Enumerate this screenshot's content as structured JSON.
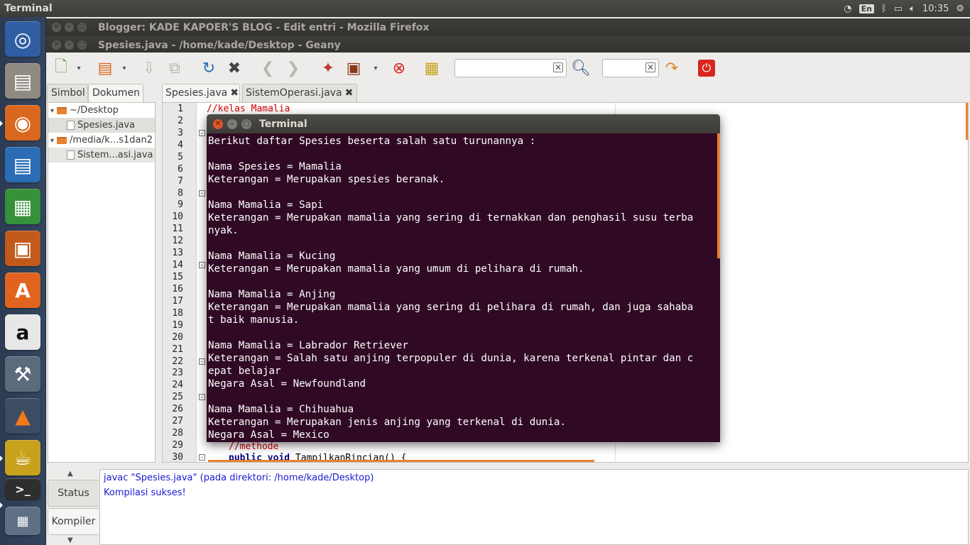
{
  "top_panel": {
    "title": "Terminal",
    "lang": "En",
    "clock": "10:35"
  },
  "windows": {
    "firefox_title": "Blogger: KADE KAPOER'S BLOG - Edit entri - Mozilla Firefox",
    "geany_title": "Spesies.java - /home/kade/Desktop - Geany"
  },
  "launcher": {
    "items": [
      "dash-home",
      "files",
      "firefox",
      "libreoffice-writer",
      "libreoffice-calc",
      "libreoffice-impress",
      "ubuntu-software-center",
      "amazon",
      "system-settings",
      "vlc",
      "geany",
      "terminal",
      "workspaces"
    ]
  },
  "sidebar": {
    "tabs": [
      "Simbol",
      "Dokumen"
    ],
    "tree": [
      {
        "label": "~/Desktop",
        "type": "folder"
      },
      {
        "label": "Spesies.java",
        "type": "file"
      },
      {
        "label": "/media/k...s1dan2",
        "type": "folder"
      },
      {
        "label": "Sistem...asi.java",
        "type": "file"
      }
    ]
  },
  "editor": {
    "tabs": [
      "Spesies.java",
      "SistemOperasi.java"
    ],
    "line_numbers": [
      "1",
      "2",
      "3",
      "4",
      "5",
      "6",
      "7",
      "8",
      "9",
      "10",
      "11",
      "12",
      "13",
      "14",
      "15",
      "16",
      "17",
      "18",
      "19",
      "20",
      "21",
      "22",
      "23",
      "24",
      "25",
      "26",
      "27",
      "28",
      "29",
      "30"
    ],
    "visible_code": {
      "line1": "//kelas Mamalia",
      "line29": "//methode",
      "line30_kw": "public void",
      "line30_rest": " TampilkanRincian() {"
    }
  },
  "terminal": {
    "title": "Terminal",
    "lines": [
      "Berikut daftar Spesies beserta salah satu turunannya :",
      "",
      "Nama Spesies = Mamalia",
      "Keterangan = Merupakan spesies beranak.",
      "",
      "Nama Mamalia = Sapi",
      "Keterangan = Merupakan mamalia yang sering di ternakkan dan penghasil susu terba",
      "nyak.",
      "",
      "Nama Mamalia = Kucing",
      "Keterangan = Merupakan mamalia yang umum di pelihara di rumah.",
      "",
      "Nama Mamalia = Anjing",
      "Keterangan = Merupakan mamalia yang sering di pelihara di rumah, dan juga sahaba",
      "t baik manusia.",
      "",
      "Nama Mamalia = Labrador Retriever",
      "Keterangan = Salah satu anjing terpopuler di dunia, karena terkenal pintar dan c",
      "epat belajar",
      "Negara Asal = Newfoundland",
      "",
      "Nama Mamalia = Chihuahua",
      "Keterangan = Merupakan jenis anjing yang terkenal di dunia.",
      "Negara Asal = Mexico"
    ]
  },
  "messages": {
    "tabs": [
      "Status",
      "Kompiler"
    ],
    "lines": [
      "javac \"Spesies.java\" (pada direktori: /home/kade/Desktop)",
      "Kompilasi sukses!"
    ]
  },
  "colors": {
    "terminal_bg": "#300a24",
    "accent_orange": "#e5832e",
    "comment_red": "#cc0000",
    "keyword_navy": "#00007f",
    "compiler_text": "#1a1ad2"
  }
}
